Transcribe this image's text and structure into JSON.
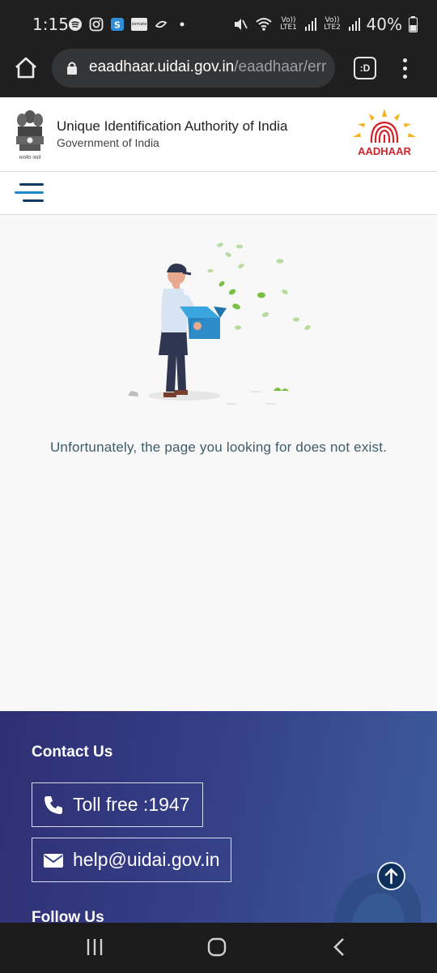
{
  "status_bar": {
    "time": "1:15",
    "left_icons": [
      "spotify-icon",
      "instagram-icon",
      "app-s-icon",
      "zomato-icon",
      "app-g-icon",
      "dot-icon"
    ],
    "zomato_label": "zomato",
    "net1_label": "Vo)) LTE1",
    "net2_label": "Vo)) LTE2",
    "battery": "40%"
  },
  "browser": {
    "url_domain": "eaadhaar.uidai.gov.in",
    "url_path": "/eaadhaar/err",
    "tab_label": ":D"
  },
  "header": {
    "org_name": "Unique Identification Authority of India",
    "org_sub": "Government of India",
    "emblem_caption": "सत्यमेव जयते",
    "logo_text": "AADHAAR"
  },
  "main": {
    "error_message": "Unfortunately, the page you looking for does not exist."
  },
  "footer": {
    "contact_title": "Contact Us",
    "toll_free": "Toll free :1947",
    "email": "help@uidai.gov.in",
    "follow_title": "Follow Us"
  },
  "colors": {
    "accent_blue": "#1e88c8",
    "aadhaar_red": "#d2232a",
    "aadhaar_yellow": "#f6b21b",
    "footer_bg": "#343e86"
  }
}
